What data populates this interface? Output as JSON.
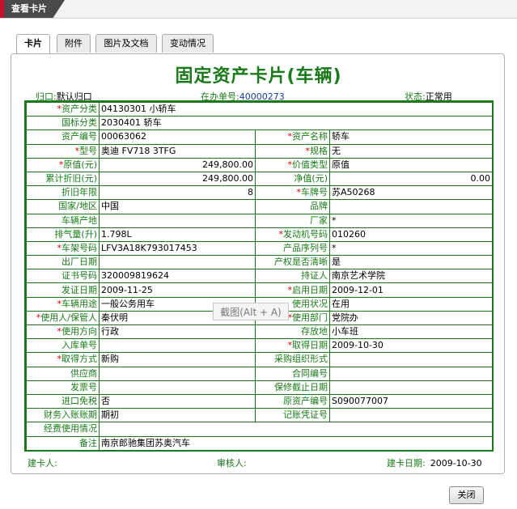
{
  "header": {
    "title": "查看卡片"
  },
  "tabs": [
    {
      "label": "卡片",
      "active": true
    },
    {
      "label": "附件"
    },
    {
      "label": "图片及文档"
    },
    {
      "label": "变动情况"
    }
  ],
  "card": {
    "title": "固定资产卡片(车辆)",
    "belong_label": "归口:",
    "belong_value": "默认归口",
    "docno_label": "在办单号:",
    "docno_value": "40000273",
    "status_label": "状态:",
    "status_value": "正常用"
  },
  "rows": [
    {
      "k1": "资产分类",
      "r1": true,
      "v1": "04130301 小轿车",
      "span": true
    },
    {
      "k1": "国标分类",
      "v1": "2030401 轿车",
      "span": true
    },
    {
      "k1": "资产编号",
      "v1": "00063062",
      "k2": "资产名称",
      "r2": true,
      "v2": "轿车"
    },
    {
      "k1": "型号",
      "r1": true,
      "v1": "奥迪 FV718 3TFG",
      "k2": "规格",
      "r2": true,
      "v2": "无"
    },
    {
      "k1": "原值(元)",
      "r1": true,
      "v1": "249,800.00",
      "n1": true,
      "k2": "价值类型",
      "r2": true,
      "v2": "原值"
    },
    {
      "k1": "累计折旧(元)",
      "v1": "249,800.00",
      "n1": true,
      "k2": "净值(元)",
      "v2": "0.00",
      "n2": true
    },
    {
      "k1": "折旧年限",
      "v1": "8",
      "n1": true,
      "k2": "车牌号",
      "r2": true,
      "v2": "苏A50268"
    },
    {
      "k1": "国家/地区",
      "v1": "中国",
      "k2": "品牌",
      "v2": ""
    },
    {
      "k1": "车辆产地",
      "v1": "",
      "k2": "厂家",
      "v2": "*"
    },
    {
      "k1": "排气量(升)",
      "v1": "1.798L",
      "k2": "发动机号码",
      "r2": true,
      "v2": "010260"
    },
    {
      "k1": "车架号码",
      "r1": true,
      "v1": "LFV3A18K793017453",
      "k2": "产品序列号",
      "v2": "*"
    },
    {
      "k1": "出厂日期",
      "v1": "",
      "k2": "产权是否清晰",
      "v2": "是"
    },
    {
      "k1": "证书号码",
      "v1": "320009819624",
      "k2": "持证人",
      "v2": "南京艺术学院"
    },
    {
      "k1": "发证日期",
      "v1": "2009-11-25",
      "k2": "启用日期",
      "r2": true,
      "v2": "2009-12-01"
    },
    {
      "k1": "车辆用途",
      "r1": true,
      "v1": "一般公务用车",
      "k2": "使用状况",
      "v2": "在用"
    },
    {
      "k1": "使用人/保管人",
      "r1": true,
      "v1": "秦伏明",
      "k2": "使用部门",
      "r2": true,
      "v2": "党院办"
    },
    {
      "k1": "使用方向",
      "r1": true,
      "v1": "行政",
      "k2": "存放地",
      "v2": "小车班"
    },
    {
      "k1": "入库单号",
      "v1": "",
      "k2": "取得日期",
      "r2": true,
      "v2": "2009-10-30"
    },
    {
      "k1": "取得方式",
      "r1": true,
      "v1": "新购",
      "k2": "采购组织形式",
      "v2": ""
    },
    {
      "k1": "供应商",
      "v1": "",
      "k2": "合同编号",
      "v2": ""
    },
    {
      "k1": "发票号",
      "v1": "",
      "k2": "保修截止日期",
      "v2": ""
    },
    {
      "k1": "进口免税",
      "v1": "否",
      "k2": "原资产编号",
      "v2": "S090077007"
    },
    {
      "k1": "财务入账账期",
      "v1": "期初",
      "k2": "记账凭证号",
      "v2": ""
    },
    {
      "k1": "经费使用情况",
      "v1": "",
      "span": true
    },
    {
      "k1": "备注",
      "v1": "南京郎驰集团苏奥汽车",
      "span": true
    }
  ],
  "footer": {
    "creator_label": "建卡人:",
    "reviewer_label": "审核人:",
    "date_label": "建卡日期:",
    "date_value": "2009-10-30"
  },
  "overlay": {
    "text": "截图(Alt + A)"
  },
  "buttons": {
    "close": "关闭"
  }
}
